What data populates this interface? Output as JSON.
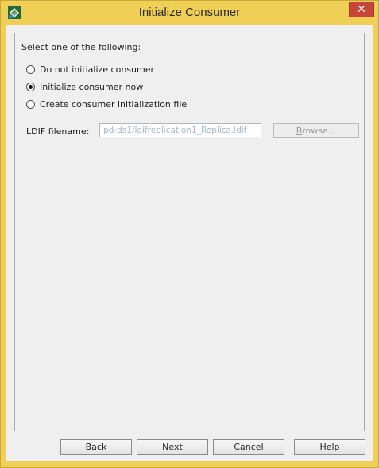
{
  "window": {
    "title": "Initialize Consumer",
    "close_glyph": "✕",
    "app_icon": "ldap-diamond-icon"
  },
  "prompt": "Select one of the following:",
  "options": [
    {
      "label": "Do not initialize consumer",
      "checked": false
    },
    {
      "label": "Initialize consumer now",
      "checked": true
    },
    {
      "label": "Create consumer initialization file",
      "checked": false
    }
  ],
  "ldif": {
    "label": "LDIF filename:",
    "value": "pd-ds1/ldifreplication1_Replica.ldif",
    "browse_label": "Browse..."
  },
  "buttons": {
    "back": "Back",
    "next": "Next",
    "cancel": "Cancel",
    "help": "Help"
  },
  "colors": {
    "frame": "#f0cf56",
    "close": "#c7463a",
    "client": "#efefef"
  }
}
